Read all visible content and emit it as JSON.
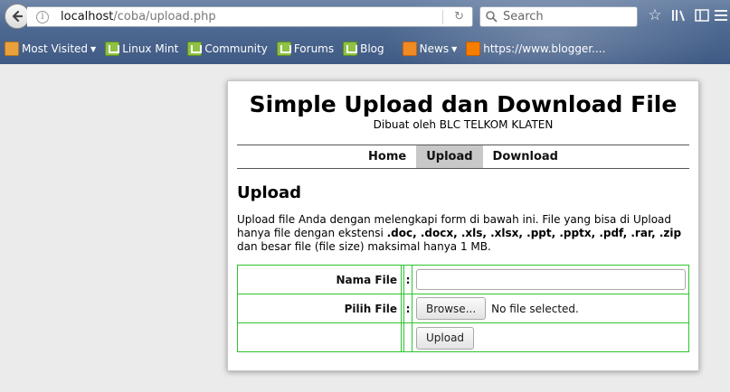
{
  "browser": {
    "url_host": "localhost",
    "url_path": "/coba/upload.php",
    "search_placeholder": "Search",
    "bookmarks": [
      {
        "label": "Most Visited",
        "icon": "folder-icon",
        "dropdown": true
      },
      {
        "label": "Linux Mint",
        "icon": "mint-icon"
      },
      {
        "label": "Community",
        "icon": "mint-icon"
      },
      {
        "label": "Forums",
        "icon": "mint-icon"
      },
      {
        "label": "Blog",
        "icon": "mint-icon"
      },
      {
        "label": "News",
        "icon": "rss-icon",
        "dropdown": true
      },
      {
        "label": "https://www.blogger....",
        "icon": "blogger-icon"
      }
    ]
  },
  "page": {
    "title": "Simple Upload dan Download File",
    "subtitle": "Dibuat oleh BLC TELKOM KLATEN",
    "nav": [
      {
        "label": "Home",
        "active": false
      },
      {
        "label": "Upload",
        "active": true
      },
      {
        "label": "Download",
        "active": false
      }
    ],
    "section_title": "Upload",
    "intro_prefix": "Upload file Anda dengan melengkapi form di bawah ini. File yang bisa di Upload hanya file dengan ekstensi ",
    "intro_extensions": ".doc, .docx, .xls, .xlsx, .ppt, .pptx, .pdf, .rar, .zip",
    "intro_suffix": " dan besar file (file size) maksimal hanya 1 MB.",
    "form": {
      "name_label": "Nama File",
      "name_value": "",
      "file_label": "Pilih File",
      "colon": ":",
      "browse_label": "Browse...",
      "no_file_text": "No file selected.",
      "upload_label": "Upload"
    }
  }
}
